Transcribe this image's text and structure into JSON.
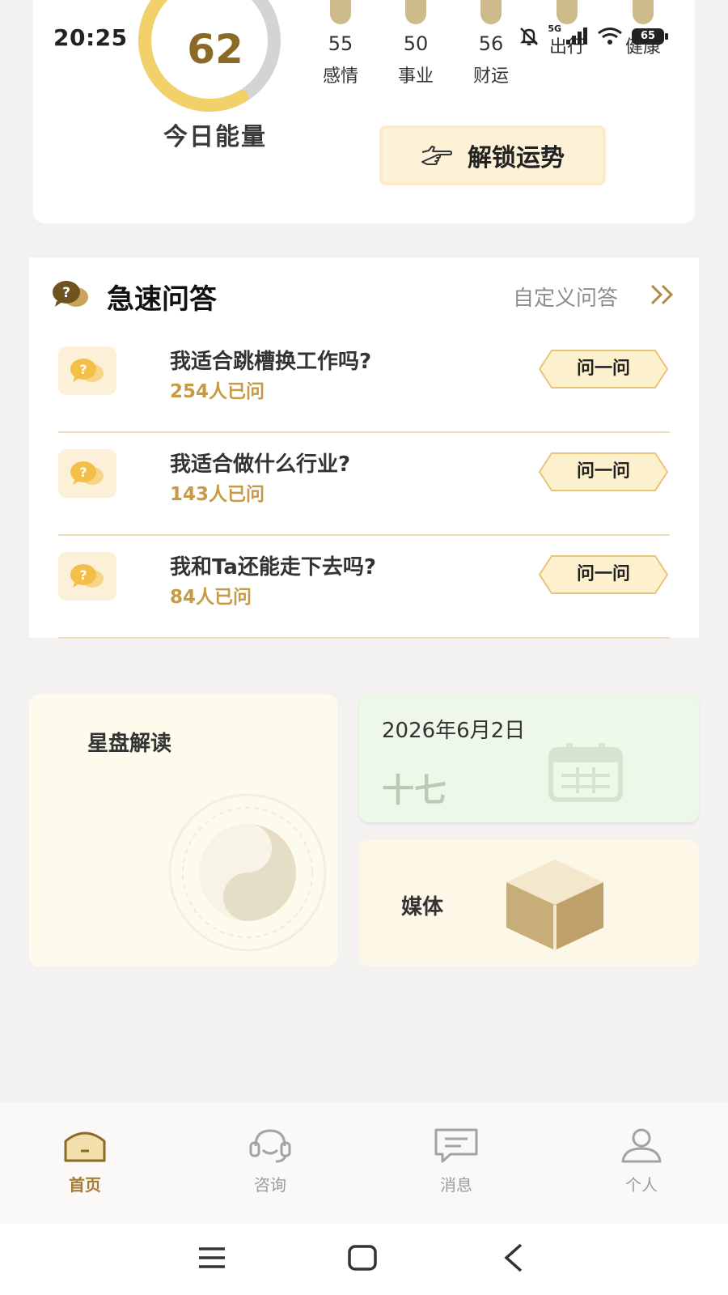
{
  "status_bar": {
    "time": "20:25",
    "network": "5G",
    "battery": "65",
    "icons": [
      "bell-off-icon",
      "signal-icon",
      "wifi-icon",
      "battery-icon"
    ]
  },
  "energy": {
    "value": "62",
    "label": "今日能量",
    "level_fraction": 0.62,
    "colors": {
      "gauge_fill": "#f2d06a",
      "gauge_track": "#d4d4d4",
      "value_text": "#8a6a26"
    },
    "fortunes": [
      {
        "score": "55",
        "name": "感情"
      },
      {
        "score": "50",
        "name": "事业"
      },
      {
        "score": "56",
        "name": "财运"
      },
      {
        "score": "",
        "name": "出行"
      },
      {
        "score": "",
        "name": "健康"
      }
    ],
    "unlock_label": "解锁运势"
  },
  "qa": {
    "title": "急速问答",
    "custom_link": "自定义问答",
    "items": [
      {
        "question": "我适合跳槽换工作吗?",
        "count": "254人已问",
        "button": "问一问"
      },
      {
        "question": "我适合做什么行业?",
        "count": "143人已问",
        "button": "问一问"
      },
      {
        "question": "我和Ta还能走下去吗?",
        "count": "84人已问",
        "button": "问一问"
      }
    ]
  },
  "tiles": {
    "astro": {
      "label": "星盘解读"
    },
    "date": {
      "date": "2026年6月2日",
      "lunar": "十七"
    },
    "media": {
      "label": "媒体"
    }
  },
  "nav": {
    "items": [
      {
        "label": "首页",
        "icon": "home-icon",
        "active": true
      },
      {
        "label": "咨询",
        "icon": "headset-icon",
        "active": false
      },
      {
        "label": "消息",
        "icon": "message-icon",
        "active": false
      },
      {
        "label": "个人",
        "icon": "person-icon",
        "active": false
      }
    ],
    "accent": "#a67b34"
  }
}
